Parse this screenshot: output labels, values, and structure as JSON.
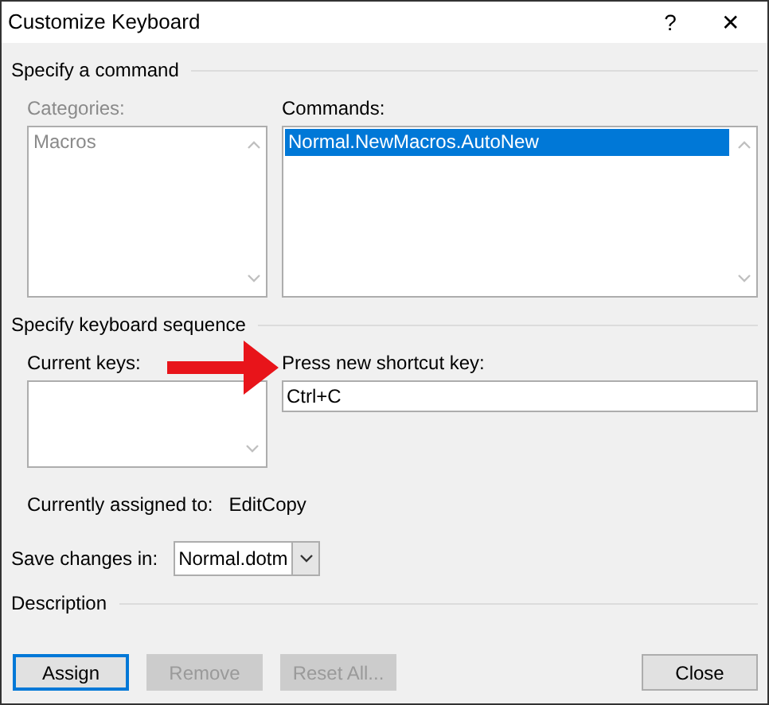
{
  "window": {
    "title": "Customize Keyboard",
    "help": "?",
    "close": "✕"
  },
  "command_section": {
    "heading": "Specify a command",
    "categories": {
      "label": "Categories:",
      "disabled": true,
      "items": [
        {
          "text": "Macros",
          "selected": false
        }
      ]
    },
    "commands": {
      "label": "Commands:",
      "disabled": false,
      "items": [
        {
          "text": "Normal.NewMacros.AutoNew",
          "selected": true
        }
      ]
    }
  },
  "keyboard_section": {
    "heading": "Specify keyboard sequence",
    "current_keys": {
      "label": "Current keys:"
    },
    "new_shortcut": {
      "label": "Press new shortcut key:",
      "value": "Ctrl+C"
    },
    "assigned_label": "Currently assigned to:",
    "assigned_value": "EditCopy"
  },
  "save_changes": {
    "label": "Save changes in:",
    "value": "Normal.dotm"
  },
  "description": {
    "heading": "Description"
  },
  "buttons": [
    {
      "label": "Assign",
      "disabled": false,
      "default": true
    },
    {
      "label": "Remove",
      "disabled": true,
      "default": false
    },
    {
      "label": "Reset All...",
      "disabled": true,
      "default": false
    },
    {
      "label": "Close",
      "disabled": false,
      "default": false
    }
  ]
}
